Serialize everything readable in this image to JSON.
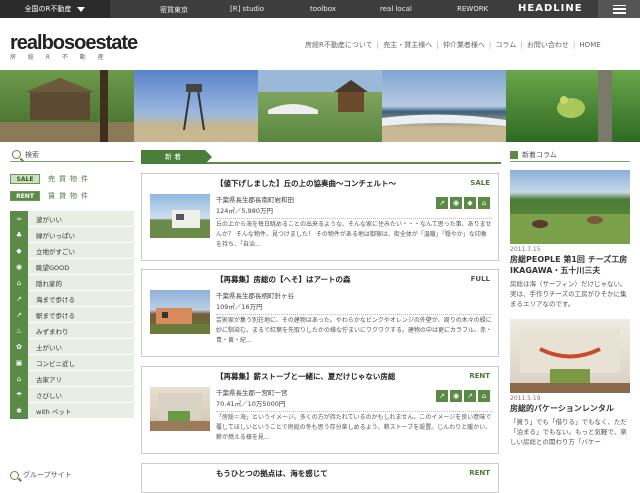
{
  "topbar": {
    "region_select": "全国のR不動産",
    "nav": [
      "密買東京",
      "[R] studio",
      "toolbox",
      "real local",
      "REWORK"
    ],
    "headline": "HEADLINE"
  },
  "header": {
    "logo": "realbosoestate",
    "logo_sub": "房 総 R 不 動 産",
    "links": [
      "房総R不動産について",
      "売主・貸主様へ",
      "仲介業者様へ",
      "コラム",
      "お問い合わせ",
      "HOME"
    ]
  },
  "sidebar": {
    "search_title": "検索",
    "tags": [
      {
        "tag": "SALE",
        "label": "売買物件"
      },
      {
        "tag": "RENT",
        "label": "賃貸物件"
      }
    ],
    "categories": [
      "波がいい",
      "緑がいっぱい",
      "立地がすごい",
      "眺望GOOD",
      "隠れ家的",
      "海まで歩ける",
      "駅まで歩ける",
      "みずまわり",
      "土がいい",
      "コンビニ近し",
      "古家アリ",
      "さびしい",
      "with ペット"
    ],
    "group_site": "グループサイト"
  },
  "main": {
    "section_label": "新 着",
    "listings": [
      {
        "title": "【値下げしました】丘の上の協奏曲〜コンチェルト〜",
        "badge": "SALE",
        "location": "千葉県長生郡長南町岩和田",
        "price": "124㎡／5,980万円",
        "desc": "丘の上から海を毎日眺めることの出来るような、そんな家に住みたい・・・なんて思った事、ありませんか？ そんな物件、見つけました！ その物件がある地は御宿は、街全体が「温暖」「穏やか」な印象を持ち、「自治..."
      },
      {
        "title": "【再募集】房総の【へそ】はアートの森",
        "badge": "FULL",
        "location": "千葉県長生郡長柄町針ヶ谷",
        "price": "109㎡／16万円",
        "desc": "芸術家が集う別荘地に、その建物はあった。やわらかなピンクやオレンジの外壁が、周りの木々の緑に妙に馴染む。まるで紅葉を先取りしたかの様な佇まいにワクワクする。建物の中は更にカラフル、赤・青・黄・紀..."
      },
      {
        "title": "【再募集】薪ストーブと一緒に、夏だけじゃない房総",
        "badge": "RENT",
        "location": "千葉県長生郡一宮町一宮",
        "price": "70.41㎡／10万5000円",
        "desc": "「房総＝海」というイメージ。多くの方が持たれているのかもしれません。このイメージを良い意味で覆してほしいということで房総の冬も思う存分楽しめるよう、薪ストーブを設置。じんわりと暖かい、薪が燃える様を見..."
      },
      {
        "title": "もうひとつの拠点は、海を感じて",
        "badge": "RENT",
        "location": "",
        "price": "",
        "desc": ""
      }
    ]
  },
  "column": {
    "title": "新着コラム",
    "items": [
      {
        "date": "2011.7.15",
        "title": "房総PEOPLE 第1回 チーズ工房IKAGAWA・五十川三夫",
        "text": "房総は海（サーフィン）だけじゃない。実は、手作りチーズの工房がひそかに集まるエリアなのです。"
      },
      {
        "date": "2011.5.19",
        "title": "房総的バケーションレンタル",
        "text": "「買う」でも「借りる」でもなく、ただ「泊まる」でもない。もっと気軽で、楽しい房総との関わり方「バケー"
      }
    ]
  }
}
